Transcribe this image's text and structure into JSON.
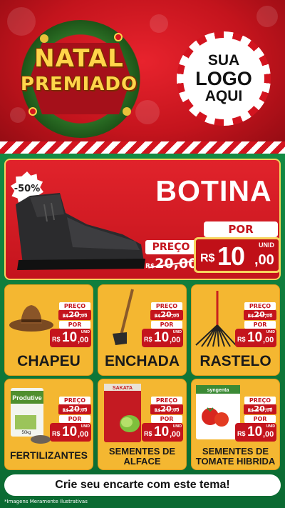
{
  "header": {
    "logo_line1": "NATAL",
    "logo_line2": "PREMIADO",
    "store_logo_lines": [
      "SUA",
      "LOGO",
      "AQUI"
    ]
  },
  "featured": {
    "discount": "-50%",
    "title": "BOTINA",
    "preco_label": "PREÇO",
    "old_currency": "R$",
    "old_price": "20,00",
    "por_label": "POR",
    "new_currency": "R$",
    "new_price_int": "10",
    "new_price_cents": ",00",
    "unit": "UNID"
  },
  "price_labels": {
    "preco": "PREÇO",
    "por": "POR",
    "old_currency": "R$",
    "old_int": "20",
    "old_cents": ",00",
    "new_currency": "R$",
    "new_int": "10",
    "new_cents": ",00",
    "unit": "UNID"
  },
  "products": [
    {
      "name": "CHAPEU",
      "icon": "hat-icon"
    },
    {
      "name": "ENCHADA",
      "icon": "hoe-icon"
    },
    {
      "name": "RASTELO",
      "icon": "rake-icon"
    },
    {
      "name": "FERTILIZANTES",
      "icon": "fertilizer-bag-icon"
    },
    {
      "name_line1": "SEMENTES DE",
      "name_line2": "ALFACE",
      "icon": "seed-packet-icon"
    },
    {
      "name_line1": "SEMENTES DE",
      "name_line2": "TOMATE HIBRIDA",
      "icon": "seed-packet-icon"
    }
  ],
  "product_labels": {
    "fertilizer_brand": "Produtive",
    "fertilizer_weight": "50kg",
    "sakata_brand": "SAKATA",
    "tomato_brand": "syngenta"
  },
  "cta": "Crie seu encarte com este tema!",
  "disclaimer": "*Imagens Meramente Ilustrativas",
  "colors": {
    "red": "#c4141d",
    "green": "#0d6b33",
    "card_yellow": "#f4b731",
    "gold": "#f6d35d"
  }
}
